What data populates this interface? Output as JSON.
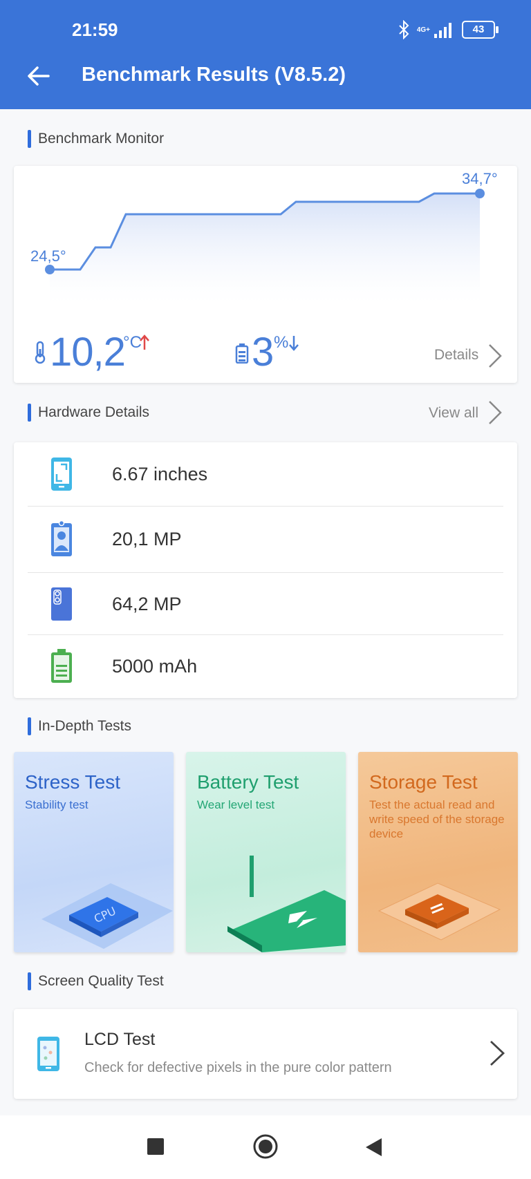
{
  "status": {
    "time": "21:59",
    "network": "4G+",
    "battery": "43"
  },
  "header": {
    "title": "Benchmark Results (V8.5.2)"
  },
  "monitor": {
    "section_title": "Benchmark Monitor",
    "start_label": "24,5°",
    "end_label": "34,7°",
    "temp_delta": "10,2",
    "temp_unit": "°C",
    "battery_delta": "3",
    "battery_unit": "%",
    "details_label": "Details"
  },
  "hardware": {
    "section_title": "Hardware Details",
    "view_all": "View all",
    "items": [
      {
        "icon": "screen-size-icon",
        "value": "6.67 inches"
      },
      {
        "icon": "front-camera-icon",
        "value": "20,1 MP"
      },
      {
        "icon": "rear-camera-icon",
        "value": "64,2 MP"
      },
      {
        "icon": "battery-icon",
        "value": "5000 mAh"
      }
    ]
  },
  "indepth": {
    "section_title": "In-Depth Tests",
    "tests": [
      {
        "title": "Stress Test",
        "subtitle": "Stability test",
        "color": "#2d63c8"
      },
      {
        "title": "Battery Test",
        "subtitle": "Wear level test",
        "color": "#1f9f6e"
      },
      {
        "title": "Storage Test",
        "subtitle": "Test the actual read and write speed of the storage device",
        "color": "#d2691e"
      }
    ]
  },
  "screen_quality": {
    "section_title": "Screen Quality Test",
    "lcd_title": "LCD Test",
    "lcd_desc": "Check for defective pixels in the pure color pattern"
  },
  "colors": {
    "accent": "#3a74d8",
    "chart_line": "#5b8ee0"
  }
}
